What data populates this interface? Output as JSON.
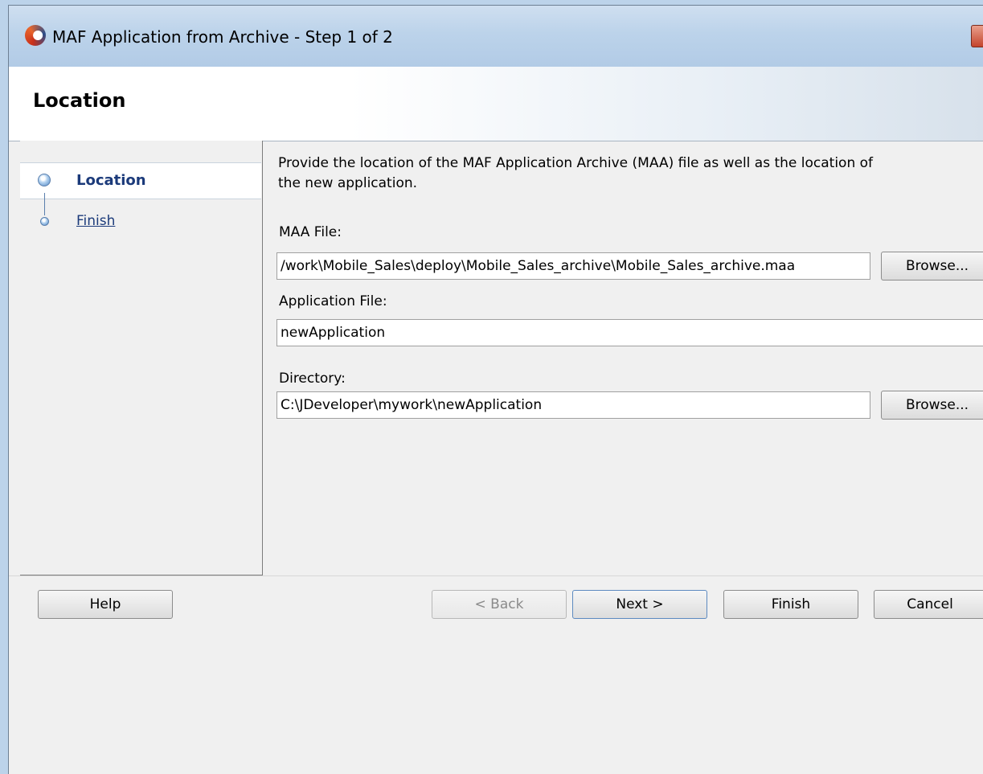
{
  "window": {
    "title": "MAF Application from Archive - Step 1 of 2"
  },
  "header": {
    "title": "Location"
  },
  "nav": {
    "items": [
      {
        "label": "Location",
        "state": "selected"
      },
      {
        "label": "Finish",
        "state": "link"
      }
    ]
  },
  "content": {
    "description": "Provide the location of the MAF Application Archive (MAA) file as well as the location of the new application.",
    "maa_file": {
      "label": "MAA File:",
      "value": "/work\\Mobile_Sales\\deploy\\Mobile_Sales_archive\\Mobile_Sales_archive.maa",
      "browse_label": "Browse..."
    },
    "application_file": {
      "label": "Application File:",
      "value": "newApplication"
    },
    "directory": {
      "label": "Directory:",
      "value": "C:\\JDeveloper\\mywork\\newApplication",
      "browse_label": "Browse..."
    }
  },
  "footer": {
    "help": "Help",
    "back": "< Back",
    "next": "Next >",
    "finish": "Finish",
    "cancel": "Cancel"
  }
}
